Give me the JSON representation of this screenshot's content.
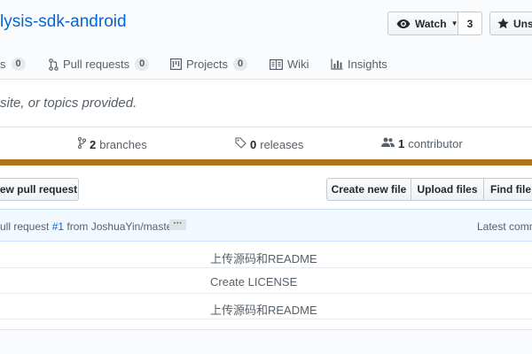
{
  "repo": {
    "title": "lysis-sdk-android"
  },
  "header_buttons": {
    "watch_label": "Watch",
    "watch_count": "3",
    "star_label": "Unst"
  },
  "tabs": [
    {
      "label": "s",
      "count": "0"
    },
    {
      "label": "Pull requests",
      "count": "0"
    },
    {
      "label": "Projects",
      "count": "0"
    },
    {
      "label": "Wiki"
    },
    {
      "label": "Insights"
    }
  ],
  "description": "site, or topics provided.",
  "summary": {
    "branches_count": "2",
    "branches_label": "branches",
    "releases_count": "0",
    "releases_label": "releases",
    "contributors_count": "1",
    "contributors_label": "contributor"
  },
  "language_color": "#b07219",
  "actions": {
    "pull_request": "ew pull request",
    "create_file": "Create new file",
    "upload_files": "Upload files",
    "find_file": "Find file"
  },
  "latest_commit": {
    "prefix": "ull request ",
    "link": "#1",
    "suffix": " from JoshuaYin/master",
    "ellipsis": "···",
    "latest_label": "Latest comm"
  },
  "files": [
    {
      "message": "上传源码和README"
    },
    {
      "message": "Create LICENSE"
    },
    {
      "message": "上传源码和README"
    }
  ]
}
